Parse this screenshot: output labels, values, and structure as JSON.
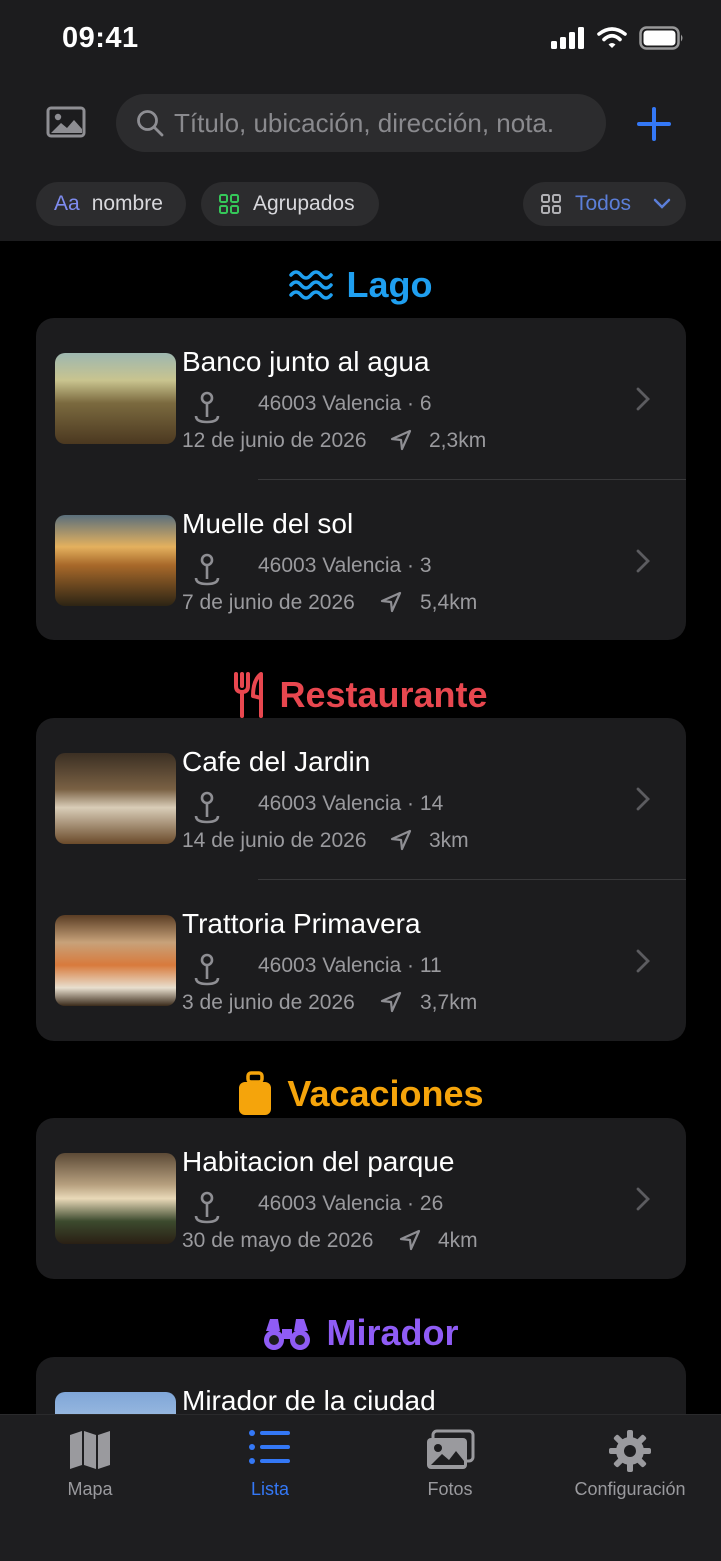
{
  "status_bar": {
    "time": "09:41"
  },
  "search": {
    "placeholder": "Título, ubicación, dirección, nota."
  },
  "filters": {
    "sort_icon_text": "Aa",
    "sort_label": "nombre",
    "group_label": "Agrupados",
    "scope_label": "Todos"
  },
  "sections": [
    {
      "title": "Lago",
      "color": "#1f9ff0",
      "icon": "water-waves-icon",
      "items": [
        {
          "title": "Banco junto al agua",
          "address": "46003 Valencia · 6",
          "date": "12 de junio de 2026",
          "distance": "2,3km"
        },
        {
          "title": "Muelle del sol",
          "address": "46003 Valencia · 3",
          "date": "7 de junio de 2026",
          "distance": "5,4km"
        }
      ]
    },
    {
      "title": "Restaurante",
      "color": "#e8474f",
      "icon": "fork-knife-icon",
      "items": [
        {
          "title": "Cafe del Jardin",
          "address": "46003 Valencia · 14",
          "date": "14 de junio de 2026",
          "distance": "3km"
        },
        {
          "title": "Trattoria Primavera",
          "address": "46003 Valencia · 11",
          "date": "3 de junio de 2026",
          "distance": "3,7km"
        }
      ]
    },
    {
      "title": "Vacaciones",
      "color": "#f5a40b",
      "icon": "suitcase-icon",
      "items": [
        {
          "title": "Habitacion del parque",
          "address": "46003 Valencia · 26",
          "date": "30 de mayo de 2026",
          "distance": "4km"
        }
      ]
    },
    {
      "title": "Mirador",
      "color": "#8f5cf5",
      "icon": "binoculars-icon",
      "items": [
        {
          "title": "Mirador de la ciudad"
        }
      ]
    }
  ],
  "tabbar": {
    "tabs": [
      {
        "label": "Mapa",
        "icon": "map-icon"
      },
      {
        "label": "Lista",
        "icon": "list-icon",
        "active": true
      },
      {
        "label": "Fotos",
        "icon": "photos-icon"
      },
      {
        "label": "Configuración",
        "icon": "gear-icon"
      }
    ]
  },
  "colors": {
    "accent": "#3478f6",
    "background": "#000000",
    "card": "#1c1c1e"
  }
}
